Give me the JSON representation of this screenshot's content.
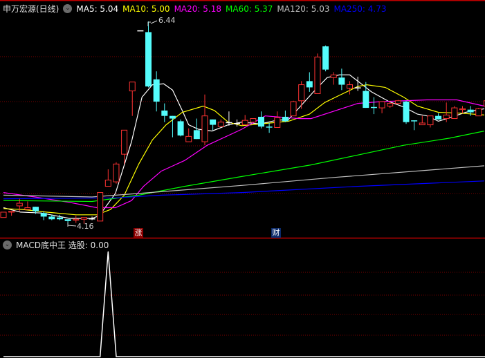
{
  "header": {
    "title": "申万宏源(日线)",
    "indicators": [
      {
        "label": "MA5: 5.04",
        "color": "#ffffff"
      },
      {
        "label": "MA10: 5.00",
        "color": "#ffff00"
      },
      {
        "label": "MA20: 5.18",
        "color": "#ff00ff"
      },
      {
        "label": "MA60: 5.37",
        "color": "#00ff00"
      },
      {
        "label": "MA120: 5.03",
        "color": "#c0c0c0"
      },
      {
        "label": "MA250: 4.73",
        "color": "#0000ff"
      }
    ]
  },
  "sub_panel": {
    "title": "MACD底中王 选股: 0.00"
  },
  "markers": {
    "high_label": "6.44",
    "low_label": "4.16",
    "badge_up": "涨",
    "badge_fin": "财"
  },
  "colors": {
    "up": "#ff3232",
    "down": "#54fcfc",
    "flat": "#ffffff",
    "grid": "#7a0000",
    "separator": "#c00000"
  },
  "chart_data": [
    {
      "type": "candlestick",
      "title": "",
      "ohlc_order": [
        "open",
        "high",
        "low",
        "close"
      ],
      "price_high": 6.44,
      "price_low": 4.16,
      "grid": true,
      "candles": [
        [
          4.24,
          4.3,
          4.24,
          4.3
        ],
        [
          4.3,
          4.31,
          4.26,
          4.31
        ],
        [
          4.37,
          4.45,
          4.31,
          4.4
        ],
        [
          4.33,
          4.42,
          4.33,
          4.35
        ],
        [
          4.36,
          4.36,
          4.28,
          4.31
        ],
        [
          4.29,
          4.31,
          4.21,
          4.25
        ],
        [
          4.25,
          4.27,
          4.21,
          4.22
        ],
        [
          4.24,
          4.27,
          4.21,
          4.22
        ],
        [
          4.22,
          4.22,
          4.16,
          4.2
        ],
        [
          4.21,
          4.26,
          4.18,
          4.22
        ],
        [
          4.22,
          4.24,
          4.17,
          4.24
        ],
        [
          4.23,
          4.25,
          4.21,
          4.23
        ],
        [
          4.2,
          4.52,
          4.2,
          4.52
        ],
        [
          4.59,
          4.78,
          4.59,
          4.66
        ],
        [
          4.64,
          4.86,
          4.62,
          4.84
        ],
        [
          4.95,
          5.22,
          4.84,
          5.22
        ],
        [
          5.66,
          5.76,
          5.38,
          5.76
        ],
        [
          6.34,
          6.34,
          6.34,
          6.34
        ],
        [
          6.32,
          6.44,
          5.7,
          5.71
        ],
        [
          5.79,
          5.88,
          5.43,
          5.54
        ],
        [
          5.44,
          5.52,
          5.31,
          5.38
        ],
        [
          5.38,
          5.38,
          5.14,
          5.35
        ],
        [
          5.32,
          5.34,
          5.15,
          5.16
        ],
        [
          5.09,
          5.24,
          5.09,
          5.15
        ],
        [
          5.22,
          5.35,
          5.12,
          5.12
        ],
        [
          5.09,
          5.62,
          5.05,
          5.38
        ],
        [
          5.34,
          5.34,
          5.22,
          5.28
        ],
        [
          5.26,
          5.34,
          5.26,
          5.31
        ],
        [
          5.31,
          5.43,
          5.27,
          5.31
        ],
        [
          5.3,
          5.34,
          5.26,
          5.3
        ],
        [
          5.28,
          5.39,
          5.28,
          5.33
        ],
        [
          5.31,
          5.35,
          5.31,
          5.35
        ],
        [
          5.37,
          5.43,
          5.24,
          5.26
        ],
        [
          5.26,
          5.3,
          5.19,
          5.25
        ],
        [
          5.25,
          5.43,
          5.25,
          5.36
        ],
        [
          5.37,
          5.44,
          5.31,
          5.32
        ],
        [
          5.38,
          5.55,
          5.38,
          5.54
        ],
        [
          5.55,
          5.77,
          5.46,
          5.73
        ],
        [
          5.77,
          5.87,
          5.65,
          5.7
        ],
        [
          5.63,
          6.08,
          5.63,
          6.04
        ],
        [
          6.16,
          6.17,
          5.88,
          5.9
        ],
        [
          5.81,
          5.87,
          5.73,
          5.84
        ],
        [
          5.81,
          5.91,
          5.67,
          5.73
        ],
        [
          5.69,
          5.77,
          5.62,
          5.73
        ],
        [
          5.7,
          5.82,
          5.66,
          5.7
        ],
        [
          5.66,
          5.76,
          5.47,
          5.47
        ],
        [
          5.48,
          5.59,
          5.4,
          5.47
        ],
        [
          5.47,
          5.54,
          5.41,
          5.54
        ],
        [
          5.49,
          5.55,
          5.47,
          5.52
        ],
        [
          5.52,
          5.56,
          5.52,
          5.55
        ],
        [
          5.54,
          5.55,
          5.29,
          5.31
        ],
        [
          5.33,
          5.33,
          5.22,
          5.32
        ],
        [
          5.28,
          5.38,
          5.28,
          5.3
        ],
        [
          5.28,
          5.38,
          5.25,
          5.38
        ],
        [
          5.38,
          5.41,
          5.34,
          5.34
        ],
        [
          5.35,
          5.53,
          5.31,
          5.39
        ],
        [
          5.35,
          5.49,
          5.35,
          5.47
        ],
        [
          5.45,
          5.49,
          5.41,
          5.46
        ],
        [
          5.45,
          5.49,
          5.38,
          5.42
        ],
        [
          5.38,
          5.47,
          5.38,
          5.46
        ],
        [
          5.49,
          5.55,
          5.49,
          5.55
        ]
      ],
      "series": [
        {
          "name": "MA5",
          "color": "#ffffff",
          "points": [
            [
              0,
              4.35
            ],
            [
              2.1,
              4.3
            ],
            [
              4.7,
              4.29
            ],
            [
              8.2,
              4.23
            ],
            [
              11,
              4.23
            ],
            [
              11.9,
              4.26
            ],
            [
              13.9,
              4.51
            ],
            [
              15.9,
              5.09
            ],
            [
              17.2,
              5.59
            ],
            [
              18.5,
              5.73
            ],
            [
              19.9,
              5.74
            ],
            [
              21,
              5.67
            ],
            [
              22.2,
              5.44
            ],
            [
              23,
              5.28
            ],
            [
              24.2,
              5.23
            ],
            [
              25.9,
              5.21
            ],
            [
              27.9,
              5.28
            ],
            [
              29.6,
              5.31
            ],
            [
              31.9,
              5.29
            ],
            [
              33.9,
              5.33
            ],
            [
              35.4,
              5.34
            ],
            [
              36.9,
              5.49
            ],
            [
              38.5,
              5.65
            ],
            [
              40.2,
              5.81
            ],
            [
              41.7,
              5.84
            ],
            [
              43,
              5.84
            ],
            [
              44,
              5.77
            ],
            [
              45.7,
              5.65
            ],
            [
              47.9,
              5.54
            ],
            [
              49.7,
              5.48
            ],
            [
              51.4,
              5.4
            ],
            [
              52.6,
              5.38
            ],
            [
              54,
              5.32
            ],
            [
              55.4,
              5.36
            ],
            [
              57.4,
              5.42
            ],
            [
              59.7,
              5.46
            ]
          ]
        },
        {
          "name": "MA10",
          "color": "#ffff00",
          "points": [
            [
              0,
              4.34
            ],
            [
              2.4,
              4.33
            ],
            [
              5.3,
              4.3
            ],
            [
              9,
              4.27
            ],
            [
              11.6,
              4.27
            ],
            [
              13.3,
              4.33
            ],
            [
              15,
              4.49
            ],
            [
              16.8,
              4.84
            ],
            [
              18.5,
              5.11
            ],
            [
              20.2,
              5.28
            ],
            [
              22.2,
              5.42
            ],
            [
              24.8,
              5.49
            ],
            [
              26.2,
              5.44
            ],
            [
              27.9,
              5.31
            ],
            [
              29.6,
              5.27
            ],
            [
              35.4,
              5.32
            ],
            [
              38,
              5.4
            ],
            [
              39.9,
              5.53
            ],
            [
              41.7,
              5.61
            ],
            [
              44,
              5.71
            ],
            [
              45.1,
              5.73
            ],
            [
              47.4,
              5.7
            ],
            [
              49.7,
              5.59
            ],
            [
              51.4,
              5.49
            ],
            [
              54,
              5.42
            ],
            [
              56.9,
              5.41
            ],
            [
              59.7,
              5.39
            ]
          ]
        },
        {
          "name": "MA20",
          "color": "#ff00ff",
          "points": [
            [
              0,
              4.52
            ],
            [
              3.9,
              4.47
            ],
            [
              8.2,
              4.41
            ],
            [
              11.6,
              4.35
            ],
            [
              13.9,
              4.35
            ],
            [
              15.9,
              4.43
            ],
            [
              17.4,
              4.59
            ],
            [
              19.6,
              4.76
            ],
            [
              22.5,
              4.88
            ],
            [
              25.3,
              5.05
            ],
            [
              29.6,
              5.23
            ],
            [
              32.5,
              5.38
            ],
            [
              36.8,
              5.35
            ],
            [
              38.2,
              5.35
            ],
            [
              44,
              5.52
            ],
            [
              46.8,
              5.54
            ],
            [
              52.6,
              5.56
            ],
            [
              56.3,
              5.56
            ],
            [
              59.7,
              5.49
            ]
          ]
        },
        {
          "name": "MA60",
          "color": "#00ff00",
          "points": [
            [
              0,
              4.43
            ],
            [
              11,
              4.42
            ],
            [
              16.8,
              4.49
            ],
            [
              22.5,
              4.59
            ],
            [
              29.6,
              4.7
            ],
            [
              38.2,
              4.83
            ],
            [
              49.7,
              5.05
            ],
            [
              55.4,
              5.13
            ],
            [
              59.7,
              5.21
            ]
          ]
        },
        {
          "name": "MA120",
          "color": "#c0c0c0",
          "points": [
            [
              0,
              4.49
            ],
            [
              11,
              4.47
            ],
            [
              16.8,
              4.51
            ],
            [
              29.6,
              4.6
            ],
            [
              41.1,
              4.69
            ],
            [
              59.7,
              4.82
            ]
          ]
        },
        {
          "name": "MA250",
          "color": "#0000ff",
          "points": [
            [
              0,
              4.45
            ],
            [
              13.9,
              4.46
            ],
            [
              19.6,
              4.49
            ],
            [
              29.6,
              4.52
            ],
            [
              44,
              4.59
            ],
            [
              59.7,
              4.65
            ]
          ]
        }
      ]
    },
    {
      "type": "line",
      "title": "MACD底中王 选股",
      "values": [
        0,
        0,
        0,
        0,
        0,
        0,
        0,
        0,
        0,
        0,
        0,
        0,
        0,
        1,
        0,
        0,
        0,
        0,
        0,
        0,
        0,
        0,
        0,
        0,
        0,
        0,
        0,
        0,
        0,
        0,
        0,
        0,
        0,
        0,
        0,
        0,
        0,
        0,
        0,
        0,
        0,
        0,
        0,
        0,
        0,
        0,
        0,
        0,
        0,
        0,
        0,
        0,
        0,
        0,
        0,
        0,
        0,
        0,
        0,
        0,
        0
      ],
      "ylim": [
        0,
        1
      ]
    }
  ]
}
